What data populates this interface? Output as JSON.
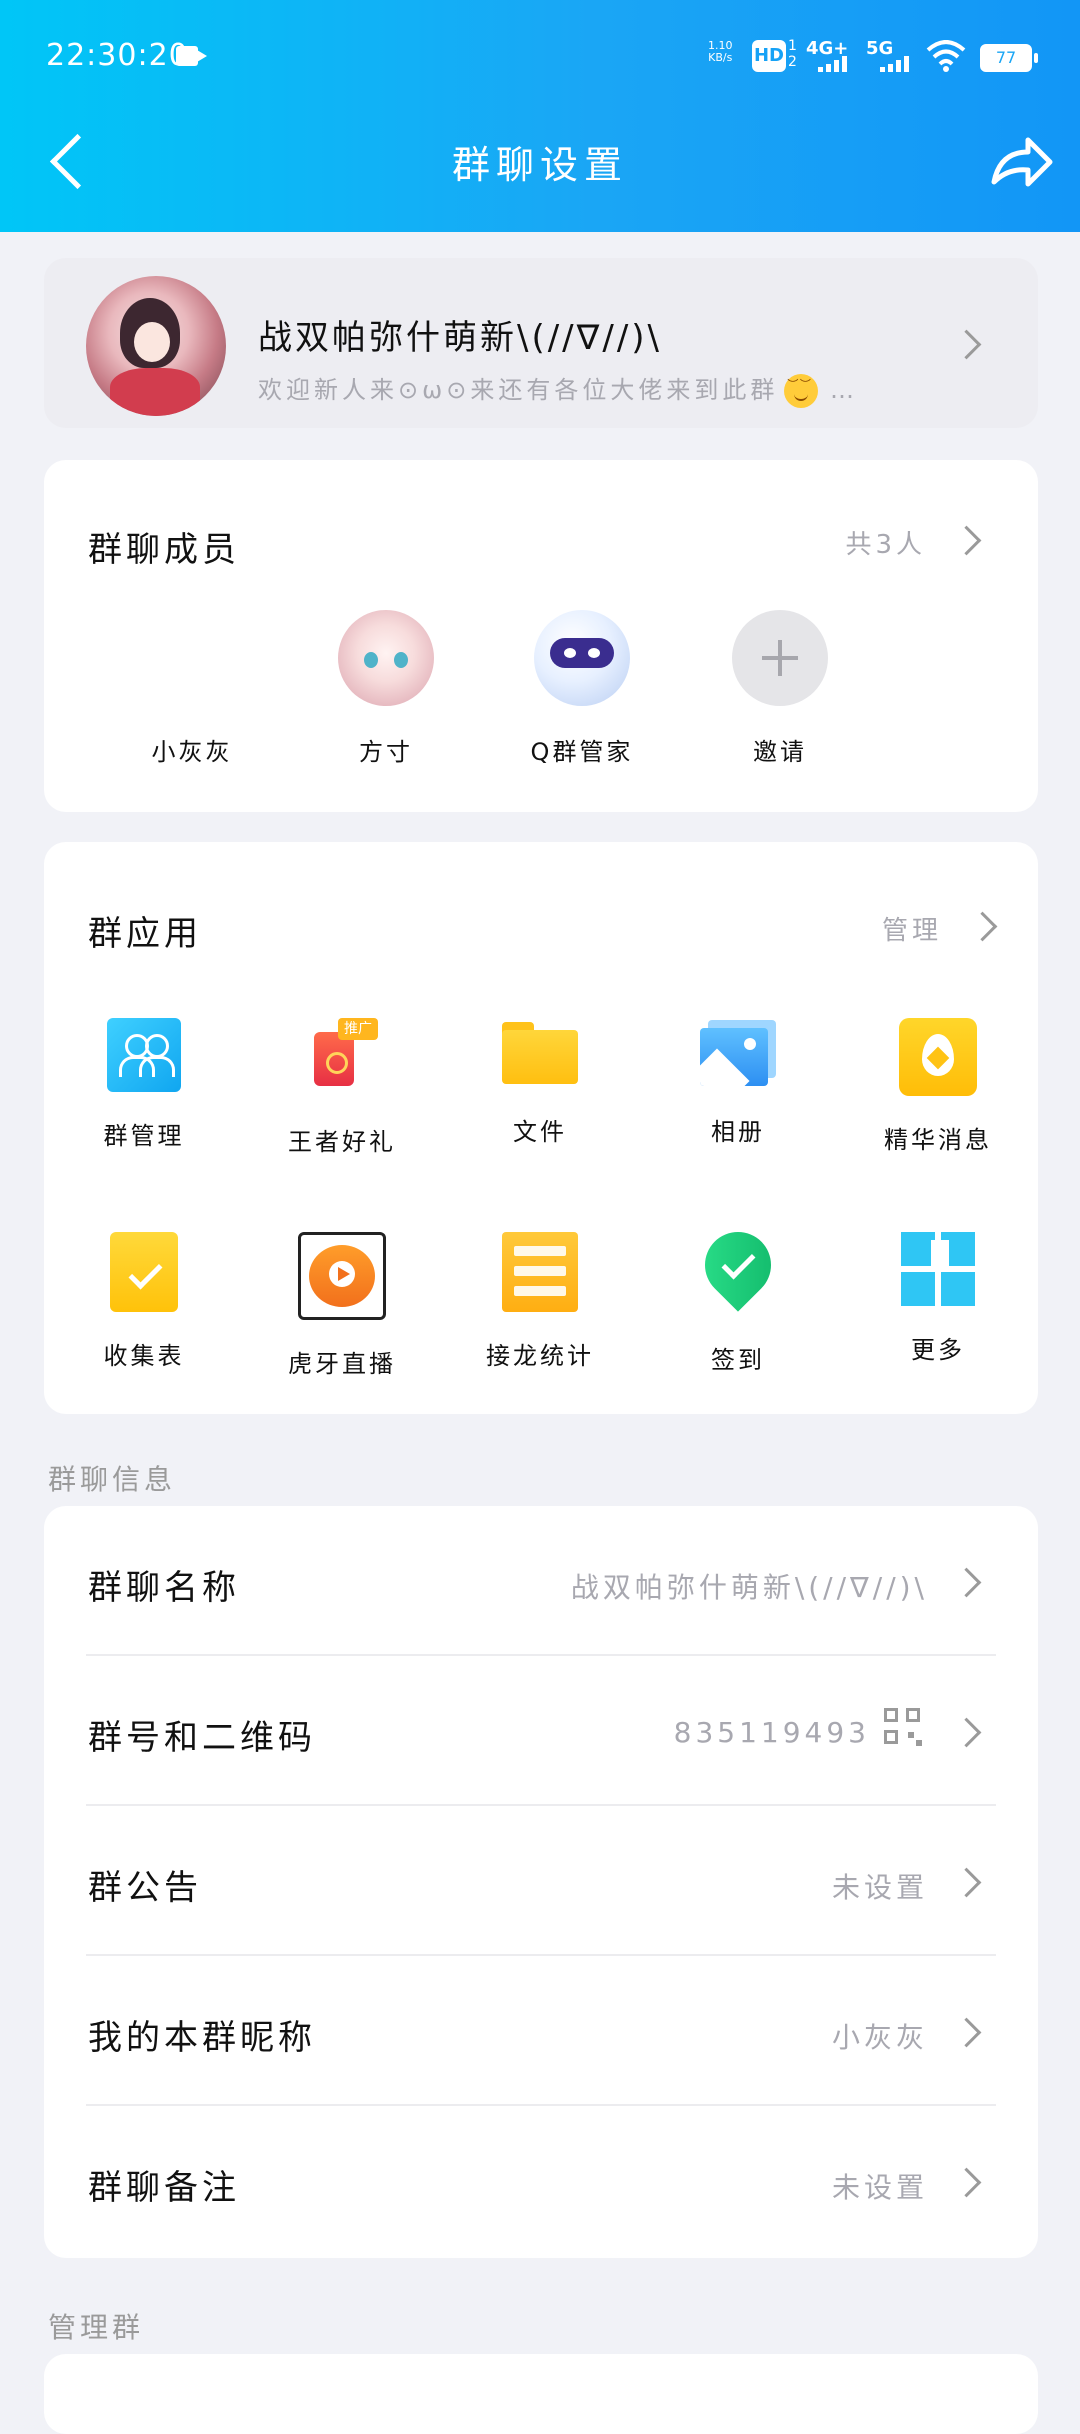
{
  "status_bar": {
    "time": "22:30:20",
    "net_speed": "1.10\nKB/s",
    "hd_badge": "HD",
    "hd_sub": "1\n2",
    "network_4g": "4G+",
    "network_5g": "5G",
    "battery": "77"
  },
  "header": {
    "title": "群聊设置"
  },
  "group": {
    "name": "战双帕弥什萌新\\(//∇//)\\",
    "description": "欢迎新人来⊙ω⊙来还有各位大佬来到此群",
    "description_suffix": "…"
  },
  "members": {
    "title": "群聊成员",
    "count_label": "共3人",
    "items": [
      {
        "name": "小灰灰"
      },
      {
        "name": "方寸"
      },
      {
        "name": "Q群管家"
      },
      {
        "name": "邀请"
      }
    ]
  },
  "apps": {
    "title": "群应用",
    "manage_label": "管理",
    "promo_badge": "推广",
    "items": [
      {
        "name": "群管理",
        "icon": "group-manage-icon"
      },
      {
        "name": "王者好礼",
        "icon": "gift-icon"
      },
      {
        "name": "文件",
        "icon": "folder-icon"
      },
      {
        "name": "相册",
        "icon": "album-icon"
      },
      {
        "name": "精华消息",
        "icon": "essence-icon"
      },
      {
        "name": "收集表",
        "icon": "collect-form-icon"
      },
      {
        "name": "虎牙直播",
        "icon": "huya-icon"
      },
      {
        "name": "接龙统计",
        "icon": "relay-stats-icon"
      },
      {
        "name": "签到",
        "icon": "checkin-icon"
      },
      {
        "name": "更多",
        "icon": "more-grid-icon"
      }
    ]
  },
  "info": {
    "section_label": "群聊信息",
    "rows": [
      {
        "label": "群聊名称",
        "value": "战双帕弥什萌新\\(//∇//)\\"
      },
      {
        "label": "群号和二维码",
        "value": "835119493"
      },
      {
        "label": "群公告",
        "value": "未设置"
      },
      {
        "label": "我的本群昵称",
        "value": "小灰灰"
      },
      {
        "label": "群聊备注",
        "value": "未设置"
      }
    ]
  },
  "manage": {
    "section_label": "管理群"
  },
  "colors": {
    "header_start": "#00c6f7",
    "header_end": "#1296f6",
    "background": "#f1f2f7"
  }
}
